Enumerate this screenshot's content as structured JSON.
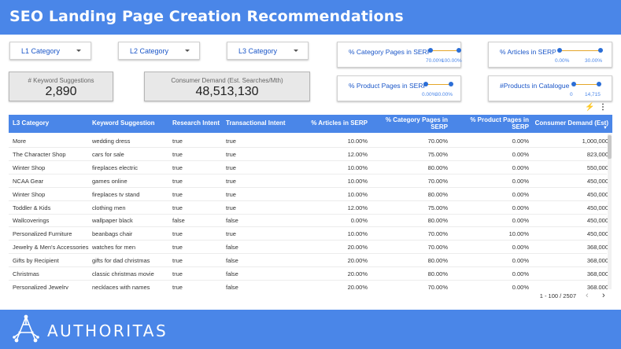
{
  "header": {
    "title": "SEO Landing Page Creation Recommendations"
  },
  "filters": [
    {
      "label": "L1 Category"
    },
    {
      "label": "L2 Category"
    },
    {
      "label": "L3 Category"
    }
  ],
  "sliders": {
    "category_pages": {
      "label": "% Category Pages in SERP",
      "min": "70.00%",
      "max": "100.00%",
      "low": 0.0,
      "high": 1.0
    },
    "articles": {
      "label": "% Articles in SERP",
      "min": "0.00%",
      "max": "30.00%",
      "low": 0.0,
      "high": 1.0
    },
    "product_pages": {
      "label": "% Product Pages in SERP",
      "min": "0.00%",
      "max": "30.00%",
      "low": 0.0,
      "high": 1.0
    },
    "products_catalogue": {
      "label": "#Products in Catalogue",
      "min": "0",
      "max": "14,715",
      "low": 0.0,
      "high": 1.0
    }
  },
  "kpis": {
    "keyword_suggestions": {
      "label": "# Keyword Suggestions",
      "value": "2,890"
    },
    "consumer_demand": {
      "label": "Consumer Demand (Est. Searches/Mth)",
      "value": "48,513,130"
    }
  },
  "toolbar": {
    "bolt_icon": "lightning-icon",
    "more_icon": "more-vert-icon"
  },
  "table": {
    "headers": [
      "L3 Category",
      "Keyword Suggestion",
      "Research Intent",
      "Transactional Intent",
      "% Articles in SERP",
      "% Category Pages in SERP",
      "% Product Pages in SERP",
      "Consumer Demand (Est)"
    ],
    "sort_indicator": "▼",
    "rows": [
      [
        "More",
        "wedding dress",
        "true",
        "true",
        "10.00%",
        "70.00%",
        "0.00%",
        "1,000,000"
      ],
      [
        "The Character Shop",
        "cars for sale",
        "true",
        "true",
        "12.00%",
        "75.00%",
        "0.00%",
        "823,000"
      ],
      [
        "Winter Shop",
        "fireplaces electric",
        "true",
        "true",
        "10.00%",
        "80.00%",
        "0.00%",
        "550,000"
      ],
      [
        "NCAA Gear",
        "games online",
        "true",
        "true",
        "10.00%",
        "70.00%",
        "0.00%",
        "450,000"
      ],
      [
        "Winter Shop",
        "fireplaces tv stand",
        "true",
        "true",
        "10.00%",
        "80.00%",
        "0.00%",
        "450,000"
      ],
      [
        "Toddler & Kids",
        "clothing men",
        "true",
        "true",
        "12.00%",
        "75.00%",
        "0.00%",
        "450,000"
      ],
      [
        "Wallcoverings",
        "wallpaper black",
        "false",
        "false",
        "0.00%",
        "80.00%",
        "0.00%",
        "450,000"
      ],
      [
        "Personalized Furniture",
        "beanbags chair",
        "true",
        "true",
        "10.00%",
        "70.00%",
        "10.00%",
        "450,000"
      ],
      [
        "Jewelry & Men's Accessories",
        "watches for men",
        "true",
        "false",
        "20.00%",
        "70.00%",
        "0.00%",
        "368,000"
      ],
      [
        "Gifts by Recipient",
        "gifts for dad christmas",
        "true",
        "false",
        "20.00%",
        "80.00%",
        "0.00%",
        "368,000"
      ],
      [
        "Christmas",
        "classic christmas movie",
        "true",
        "false",
        "20.00%",
        "80.00%",
        "0.00%",
        "368,000"
      ],
      [
        "Personalized Jewelry",
        "necklaces with names",
        "true",
        "false",
        "20.00%",
        "70.00%",
        "0.00%",
        "368,000"
      ]
    ]
  },
  "pagination": {
    "text": "1 - 100 / 2507",
    "prev": "‹",
    "next": "›"
  },
  "footer": {
    "brand": "AUTHORITAS"
  },
  "colors": {
    "brand_blue": "#4a86e8",
    "slider_track": "#e5a62a",
    "knob": "#2b6ed6"
  }
}
